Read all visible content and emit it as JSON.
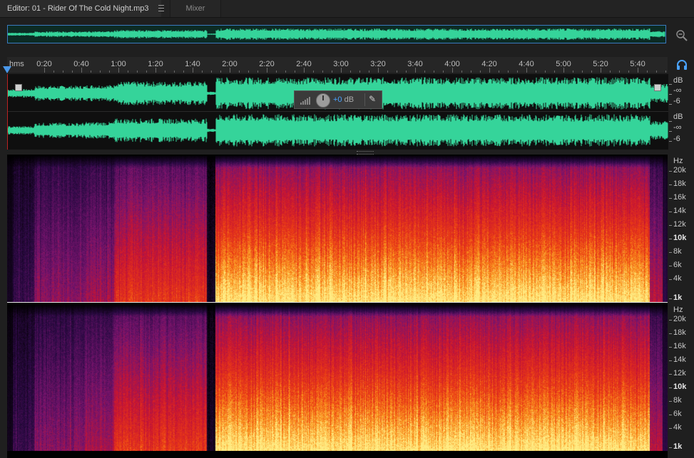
{
  "tabs": {
    "editor_label": "Editor: 01 - Rider Of The Cold Night.mp3",
    "mixer_label": "Mixer"
  },
  "timeline": {
    "unit": "hms",
    "ticks": [
      "0:20",
      "0:40",
      "1:00",
      "1:20",
      "1:40",
      "2:00",
      "2:20",
      "2:40",
      "3:00",
      "3:20",
      "3:40",
      "4:00",
      "4:20",
      "4:40",
      "5:00",
      "5:20",
      "5:40"
    ]
  },
  "hud": {
    "gain_value": "+0",
    "gain_unit": "dB"
  },
  "amplitude_ruler": {
    "ch1": [
      "dB",
      "-∞",
      "-6"
    ],
    "ch2": [
      "dB",
      "-∞",
      "-6"
    ]
  },
  "frequency_ruler": {
    "labels": [
      "Hz",
      "20k",
      "18k",
      "16k",
      "14k",
      "12k",
      "10k",
      "8k",
      "6k",
      "4k",
      "1k"
    ]
  },
  "colors": {
    "waveform": "#35d49a",
    "playhead": "#4a98ea",
    "overview_border": "#3a7ac0"
  },
  "icons": {
    "tab_menu": "hamburger-menu-icon",
    "zoom": "zoom-out-icon",
    "monitor": "headphones-icon",
    "hud_meter": "level-meter-icon",
    "hud_knob": "volume-knob-icon",
    "hud_pin": "pin-icon"
  }
}
